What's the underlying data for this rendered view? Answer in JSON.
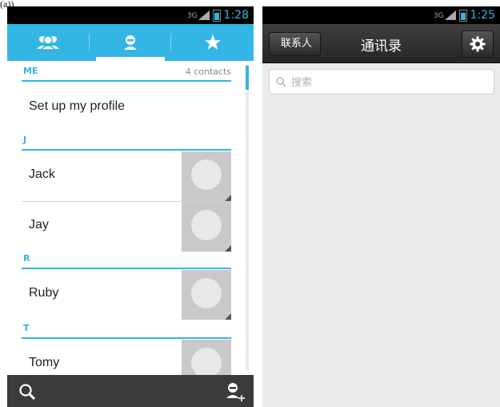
{
  "caption": "(a))",
  "left_phone": {
    "status": {
      "network": "3G",
      "time": "1:28"
    },
    "tabs": [
      {
        "name": "groups",
        "icon": "people-icon"
      },
      {
        "name": "all-contacts",
        "icon": "person-icon"
      },
      {
        "name": "favorites",
        "icon": "star-icon"
      }
    ],
    "sections": [
      {
        "letter": "ME",
        "count": "4 contacts"
      },
      {
        "letter": "J"
      },
      {
        "letter": "R"
      },
      {
        "letter": "T"
      }
    ],
    "contacts": {
      "profile": "Set up my profile",
      "jack": "Jack",
      "jay": "Jay",
      "ruby": "Ruby",
      "tomy": "Tomy"
    },
    "bottom": {
      "left_icon": "search-icon",
      "right_icon": "add-contact-icon"
    },
    "colors": {
      "accent": "#33b5e5",
      "bottom_bar": "#3b3b3b"
    }
  },
  "right_phone": {
    "status": {
      "network": "3G",
      "time": "1:25"
    },
    "back_label": "联系人",
    "title": "通讯录",
    "settings_icon": "gear-icon",
    "search_placeholder": "搜索"
  }
}
